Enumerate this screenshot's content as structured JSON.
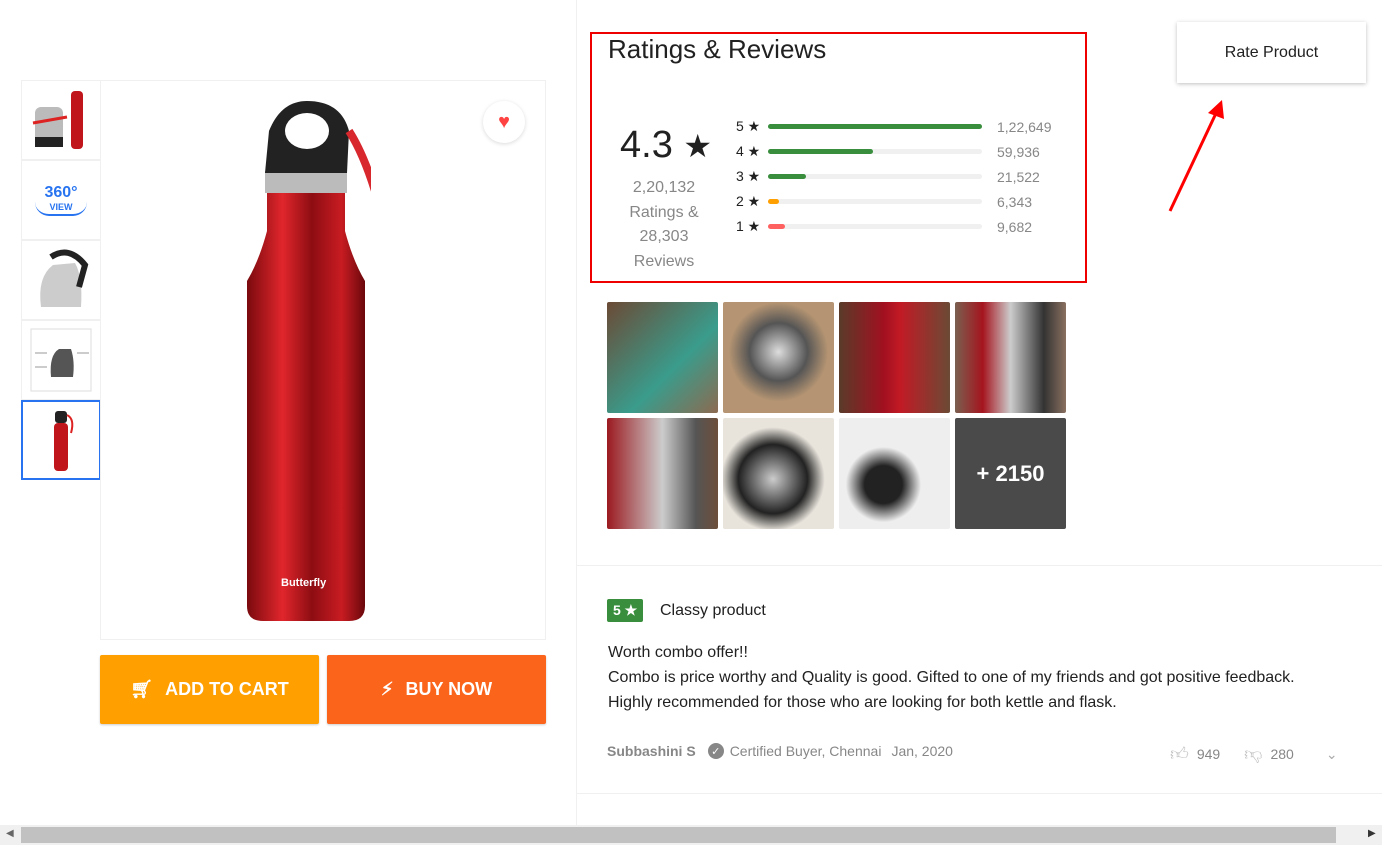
{
  "product": {
    "add_to_cart": "ADD TO CART",
    "buy_now": "BUY NOW",
    "brand_mark": "Butterfly",
    "thumb_360": "360°",
    "thumb_360_sub": "VIEW"
  },
  "ratings": {
    "title": "Ratings & Reviews",
    "average": "4.3",
    "star": "★",
    "ratings_count": "2,20,132",
    "ratings_label": "Ratings &",
    "reviews_count": "28,303",
    "reviews_label": "Reviews",
    "bars": [
      {
        "label": "5 ★",
        "count": "1,22,649",
        "value": 122649,
        "color": "#388e3c"
      },
      {
        "label": "4 ★",
        "count": "59,936",
        "value": 59936,
        "color": "#388e3c"
      },
      {
        "label": "3 ★",
        "count": "21,522",
        "value": 21522,
        "color": "#388e3c"
      },
      {
        "label": "2 ★",
        "count": "6,343",
        "value": 6343,
        "color": "#ff9f00"
      },
      {
        "label": "1 ★",
        "count": "9,682",
        "value": 9682,
        "color": "#ff6161"
      }
    ]
  },
  "rate_button": "Rate Product",
  "photos": {
    "more": "+ 2150"
  },
  "review": {
    "rating": "5 ★",
    "title": "Classy product",
    "lines": [
      "Worth combo offer!!",
      "Combo is price worthy and Quality is good. Gifted to one of my friends and got positive feedback.",
      "Highly recommended for those who are looking for both kettle and flask."
    ],
    "author": "Subbashini S",
    "certified": "Certified Buyer, Chennai",
    "date": "Jan, 2020",
    "likes": "949",
    "dislikes": "280"
  },
  "colors": {
    "add_to_cart": "#ff9f00",
    "buy_now": "#fb641b",
    "highlight": "#e00000",
    "accent": "#2874f0"
  }
}
